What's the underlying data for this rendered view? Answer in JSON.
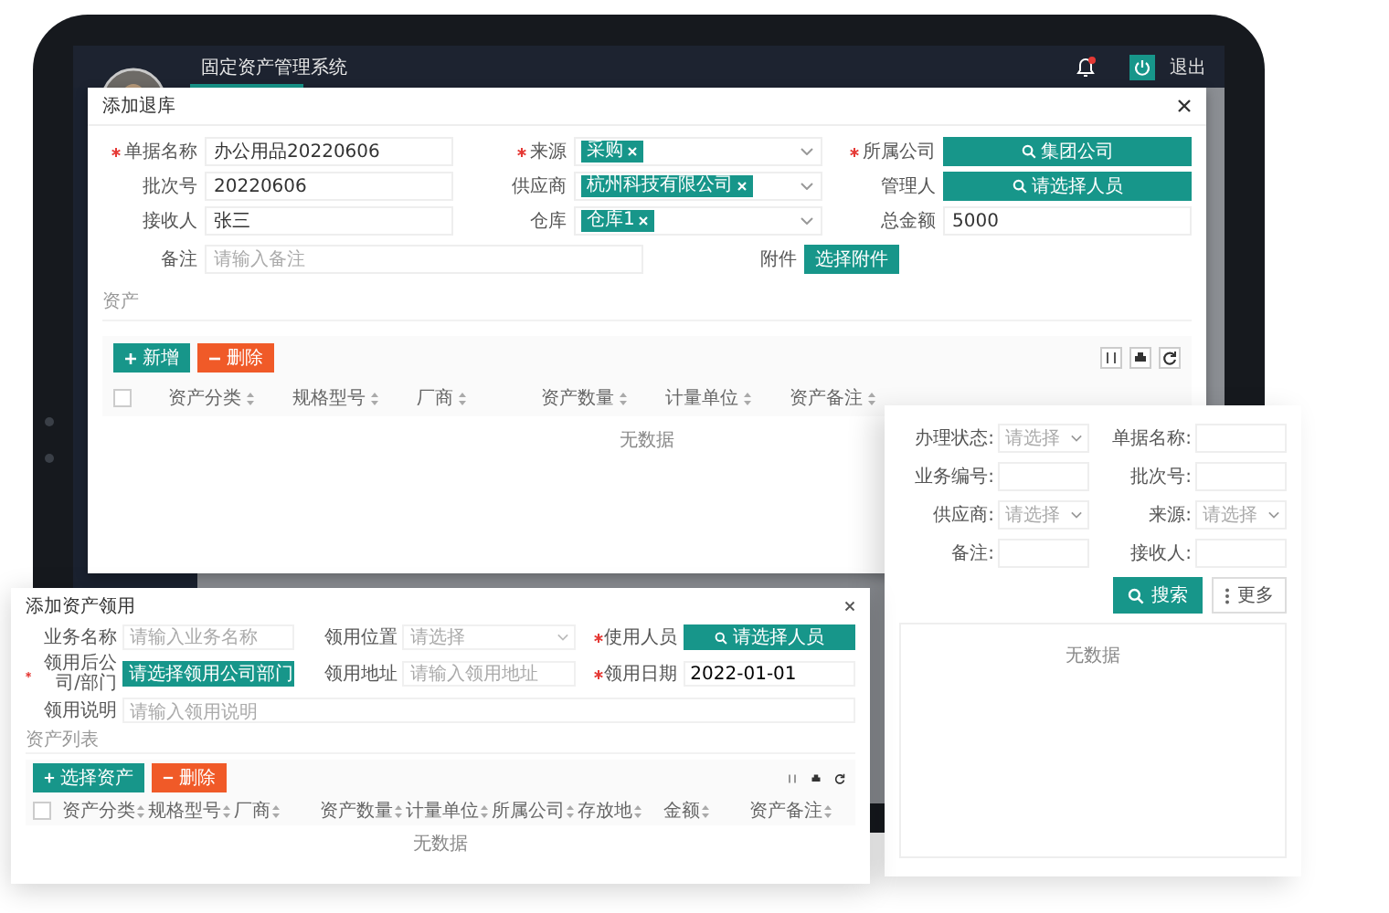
{
  "app": {
    "title": "固定资产管理系统",
    "logout": "退出"
  },
  "dialog": {
    "title": "添加退库",
    "fields": [
      {
        "kind": "text",
        "label": "单据名称",
        "required": true,
        "value": "办公用品20220606"
      },
      {
        "kind": "tags",
        "label": "来源",
        "required": true,
        "tags": [
          "采购"
        ]
      },
      {
        "kind": "button",
        "label": "所属公司",
        "required": true,
        "button": "集团公司"
      },
      {
        "kind": "text",
        "label": "批次号",
        "required": false,
        "value": "20220606"
      },
      {
        "kind": "tags",
        "label": "供应商",
        "required": false,
        "tags": [
          "杭州科技有限公司"
        ]
      },
      {
        "kind": "button",
        "label": "管理人",
        "required": false,
        "button": "请选择人员"
      },
      {
        "kind": "text",
        "label": "接收人",
        "required": false,
        "value": "张三"
      },
      {
        "kind": "tags",
        "label": "仓库",
        "required": false,
        "tags": [
          "仓库1"
        ]
      },
      {
        "kind": "text",
        "label": "总金额",
        "required": false,
        "value": "5000"
      }
    ],
    "remark": {
      "label": "备注",
      "placeholder": "请输入备注"
    },
    "attachment": {
      "label": "附件",
      "button": "选择附件"
    },
    "section": "资产",
    "add_button": "新增",
    "delete_button": "删除",
    "select_all_checked": false,
    "columns": [
      "资产分类",
      "规格型号",
      "厂商",
      "资产数量",
      "计量单位",
      "资产备注"
    ],
    "empty": "无数据"
  },
  "search_panel": {
    "fields": [
      {
        "kind": "select",
        "label": "办理状态:",
        "placeholder": "请选择"
      },
      {
        "kind": "input",
        "label": "单据名称:"
      },
      {
        "kind": "input",
        "label": "业务编号:"
      },
      {
        "kind": "input",
        "label": "批次号:"
      },
      {
        "kind": "select",
        "label": "供应商:",
        "placeholder": "请选择"
      },
      {
        "kind": "select",
        "label": "来源:",
        "placeholder": "请选择"
      },
      {
        "kind": "input",
        "label": "备注:"
      },
      {
        "kind": "input",
        "label": "接收人:"
      }
    ],
    "search_button": "搜索",
    "more_button": "更多",
    "empty": "无数据"
  },
  "borrow_dialog": {
    "title": "添加资产领用",
    "fields": [
      {
        "kind": "input",
        "label": "业务名称",
        "required": false,
        "placeholder": "请输入业务名称"
      },
      {
        "kind": "select",
        "label": "领用位置",
        "required": false,
        "placeholder": "请选择"
      },
      {
        "kind": "button",
        "label": "使用人员",
        "required": true,
        "button": "请选择人员"
      },
      {
        "kind": "button",
        "label": "领用后公司/部门",
        "required": true,
        "button": "请选择领用公司部门"
      },
      {
        "kind": "input",
        "label": "领用地址",
        "required": false,
        "placeholder": "请输入领用地址"
      },
      {
        "kind": "value",
        "label": "领用日期",
        "required": true,
        "value": "2022-01-01"
      }
    ],
    "remark": {
      "label": "领用说明",
      "placeholder": "请输入领用说明"
    },
    "section": "资产列表",
    "add_button": "选择资产",
    "delete_button": "删除",
    "select_all_checked": false,
    "columns": [
      "资产分类",
      "规格型号",
      "厂商",
      "资产数量",
      "计量单位",
      "所属公司",
      "存放地",
      "金额",
      "资产备注"
    ],
    "empty": "无数据"
  }
}
